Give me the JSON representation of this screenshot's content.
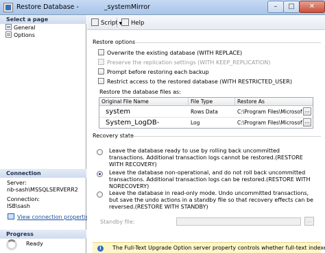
{
  "window": {
    "title": "Restore Database - ",
    "title_suffix": "_systemMirror"
  },
  "left_pane": {
    "select_page_header": "Select a page",
    "pages": [
      {
        "label": "General"
      },
      {
        "label": "Options"
      }
    ],
    "connection_header": "Connection",
    "server_label": "Server:",
    "server_value": "nb-sash\\MSSQLSERVERR2",
    "connection_label": "Connection:",
    "connection_value": "ISB\\sash",
    "view_properties_link": "View connection properties",
    "progress_header": "Progress",
    "progress_status": "Ready"
  },
  "toolbar": {
    "script_label": "Script",
    "help_label": "Help"
  },
  "restore_options": {
    "title": "Restore options",
    "options": [
      {
        "label": "Overwrite the existing database (WITH REPLACE)",
        "checked": false,
        "enabled": true
      },
      {
        "label": "Preserve the replication settings (WITH KEEP_REPLICATION)",
        "checked": false,
        "enabled": false
      },
      {
        "label": "Prompt before restoring each backup",
        "checked": false,
        "enabled": true
      },
      {
        "label": "Restrict access to the restored database (WITH RESTRICTED_USER)",
        "checked": false,
        "enabled": true
      }
    ]
  },
  "files": {
    "title": "Restore the database files as:",
    "columns": [
      "Original File Name",
      "File Type",
      "Restore As"
    ],
    "rows": [
      {
        "original": "system",
        "type": "Rows Data",
        "restore_as": "C:\\Program Files\\Microsoft SQL..."
      },
      {
        "original": "System_LogDB-",
        "type": "Log",
        "restore_as": "C:\\Program Files\\Microsoft SQL..."
      }
    ],
    "browse_label": "..."
  },
  "recovery": {
    "title": "Recovery state",
    "options": [
      {
        "text": "Leave the database ready to use by rolling back uncommitted transactions. Additional transaction logs cannot be restored.(RESTORE WITH RECOVERY)",
        "checked": false
      },
      {
        "text": "Leave the database non-operational, and do not roll back uncommitted transactions. Additional transaction logs can be restored.(RESTORE WITH NORECOVERY)",
        "checked": true
      },
      {
        "text": "Leave the database in read-only mode. Undo uncommitted transactions, but save the undo actions in a standby file so that recovery effects can be reversed.(RESTORE WITH STANDBY)",
        "checked": false
      }
    ],
    "standby_label": "Standby file:",
    "standby_value": "",
    "browse_label": "..."
  },
  "info_bar": {
    "text": "The Full-Text Upgrade Option server property controls whether full-text indexes are"
  },
  "colors": {
    "accent": "#3b6fb6",
    "info_background": "#fdf6c9",
    "link": "#1a4fa0"
  }
}
